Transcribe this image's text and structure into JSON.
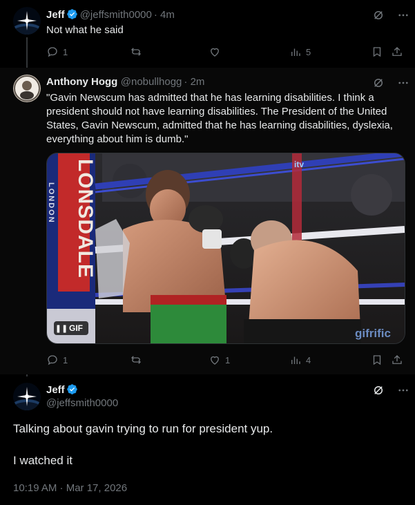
{
  "tweet1": {
    "name": "Jeff",
    "handle": "@jeffsmith0000",
    "time": "· 4m",
    "text": "Not what he said",
    "replies": "1",
    "likes": "",
    "views": "5"
  },
  "tweet2": {
    "name": "Anthony Hogg",
    "handle": "@nobullhogg",
    "time": "· 2m",
    "text": "\"Gavin Newscum has admitted that he has learning disabilities. I think a president should not have learning disabilities. The President of the United States, Gavin Newscum, admitted that he has learning disabilities, dyslexia, everything about him is dumb.\"",
    "media": {
      "gif_label": "GIF",
      "pause_glyph": "❚❚",
      "banner_text": "LONSDALE",
      "banner_sub": "LONDON",
      "watermark": "gifrific",
      "corner_logo": "itv"
    },
    "replies": "1",
    "likes": "1",
    "views": "4"
  },
  "tweet3": {
    "name": "Jeff",
    "handle": "@jeffsmith0000",
    "text_line1": "Talking about gavin trying to run for president yup.",
    "text_line2": "I watched it",
    "timestamp": "10:19 AM · Mar 17, 2026"
  },
  "colors": {
    "background": "#000000",
    "text": "#e7e9ea",
    "muted": "#71767b",
    "verified": "#1d9bf0",
    "divider": "#2f3336"
  },
  "icons": [
    "reply-icon",
    "repost-icon",
    "like-icon",
    "views-icon",
    "bookmark-icon",
    "share-icon",
    "grok-icon",
    "more-icon",
    "verified-icon"
  ]
}
